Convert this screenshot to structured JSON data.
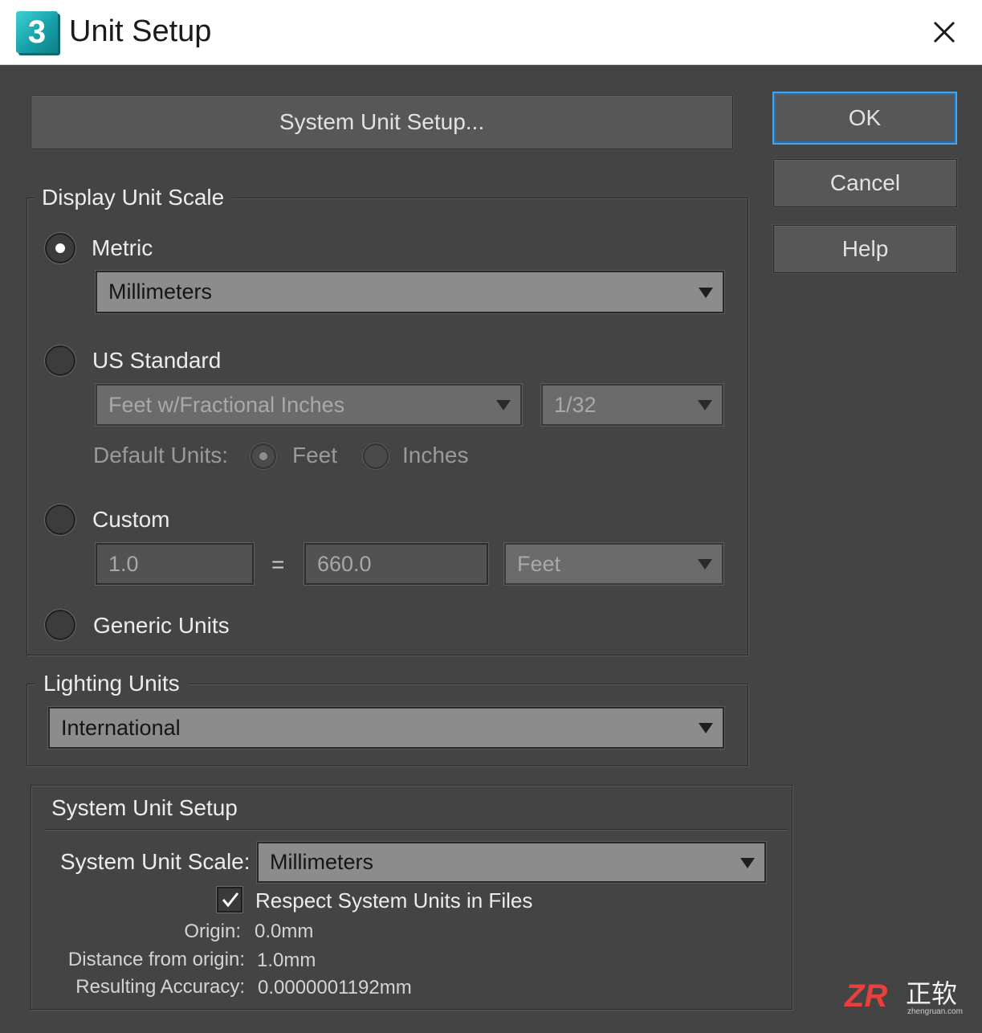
{
  "window": {
    "app_icon_label": "3",
    "title": "Unit Setup",
    "close_icon": "close-icon"
  },
  "buttons": {
    "system_unit_setup": "System Unit Setup...",
    "ok": "OK",
    "cancel": "Cancel",
    "help": "Help"
  },
  "display_unit_scale": {
    "group_title": "Display Unit Scale",
    "selected": "Metric",
    "metric": {
      "label": "Metric",
      "value": "Millimeters"
    },
    "us_standard": {
      "label": "US Standard",
      "value": "Feet w/Fractional Inches",
      "fraction": "1/32",
      "default_units_label": "Default Units:",
      "default_units_options": [
        "Feet",
        "Inches"
      ],
      "default_units_selected": "Feet"
    },
    "custom": {
      "label": "Custom",
      "left_value": "1.0",
      "equals": "=",
      "right_value": "660.0",
      "unit": "Feet"
    },
    "generic": {
      "label": "Generic Units"
    }
  },
  "lighting_units": {
    "group_title": "Lighting Units",
    "value": "International"
  },
  "system_unit_setup": {
    "group_title": "System Unit Setup",
    "scale_label": "System Unit Scale:",
    "scale_value": "Millimeters",
    "respect_label": "Respect System Units in Files",
    "respect_checked": true,
    "origin_label": "Origin:",
    "origin_value": "0.0mm",
    "distance_label": "Distance from origin:",
    "distance_value": "1.0mm",
    "accuracy_label": "Resulting Accuracy:",
    "accuracy_value": "0.0000001192mm"
  },
  "watermark": {
    "logo_text": "ZR",
    "chinese_text": "正软",
    "domain": "zhengruan.com"
  },
  "colors": {
    "background": "#444444",
    "titlebar": "#ffffff",
    "ok_focus": "#4aa3e6",
    "dropdown_bg": "#8c8c8c",
    "watermark_red": "#e8413c"
  }
}
